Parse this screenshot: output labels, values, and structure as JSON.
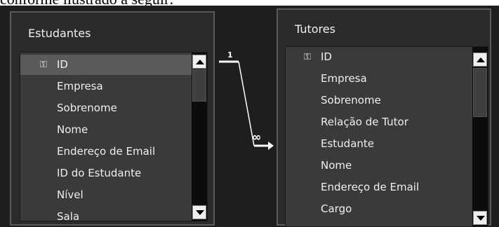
{
  "caption": "conforme ilustrado a seguir:",
  "relationship": {
    "one_label": "1",
    "many_label": "∞"
  },
  "tables": [
    {
      "title": "Estudantes",
      "fields": [
        "ID",
        "Empresa",
        "Sobrenome",
        "Nome",
        "Endereço de Email",
        "ID do Estudante",
        "Nível",
        "Sala"
      ],
      "primary_key_index": 0,
      "selected_index": 0
    },
    {
      "title": "Tutores",
      "fields": [
        "ID",
        "Empresa",
        "Sobrenome",
        "Relação de Tutor",
        "Estudante",
        "Nome",
        "Endereço de Email",
        "Cargo"
      ],
      "primary_key_index": 0,
      "selected_index": null
    }
  ],
  "icons": {
    "primary_key": "key-icon",
    "scroll_up": "scroll-up-icon",
    "scroll_down": "scroll-down-icon"
  },
  "colors": {
    "background": "#1e1e1e",
    "panel": "#2b2b2b",
    "list": "#3a3a3a",
    "selection": "#5a5a5a",
    "text": "#efefef"
  }
}
